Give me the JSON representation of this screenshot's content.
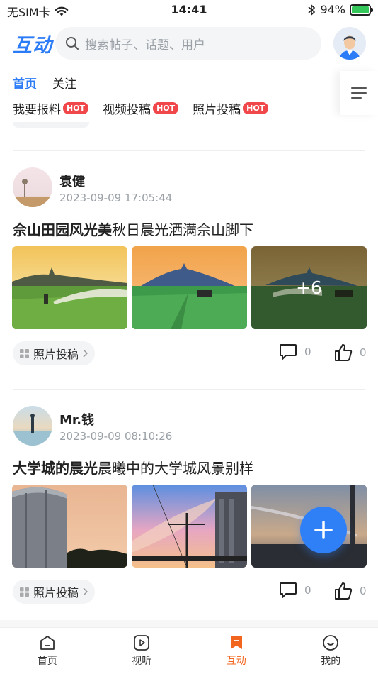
{
  "status": {
    "carrier": "无SIM卡",
    "time": "14:41",
    "battery": "94%",
    "battery_level": 0.94
  },
  "header": {
    "logo": "互动",
    "search_placeholder": "搜索帖子、话题、用户"
  },
  "tabs": [
    {
      "label": "首页",
      "active": true
    },
    {
      "label": "关注",
      "active": false
    }
  ],
  "categories": [
    {
      "label": "我要报料",
      "badge": "HOT"
    },
    {
      "label": "视频投稿",
      "badge": "HOT"
    },
    {
      "label": "照片投稿",
      "badge": "HOT"
    }
  ],
  "posts": [
    {
      "user": "袁健",
      "date": "2023-09-09 17:05:44",
      "title_bold": "佘山田园风光美",
      "title_rest": "秋日晨光洒满佘山脚下",
      "more_count": "+6",
      "tag": "照片投稿",
      "comments": "0",
      "likes": "0"
    },
    {
      "user": "Mr.钱",
      "date": "2023-09-09 08:10:26",
      "title_bold": "大学城的晨光",
      "title_rest": "晨曦中的大学城风景别样",
      "tag": "照片投稿",
      "comments": "0",
      "likes": "0"
    }
  ],
  "bottom_nav": [
    {
      "label": "首页",
      "icon": "home-icon",
      "active": false
    },
    {
      "label": "视听",
      "icon": "play-icon",
      "active": false
    },
    {
      "label": "互动",
      "icon": "bookmark-icon",
      "active": true
    },
    {
      "label": "我的",
      "icon": "smile-icon",
      "active": false
    }
  ],
  "colors": {
    "accent": "#2b7cf6",
    "hot": "#f0474a",
    "active_nav": "#f2651e",
    "fab": "#2f7ff7"
  }
}
